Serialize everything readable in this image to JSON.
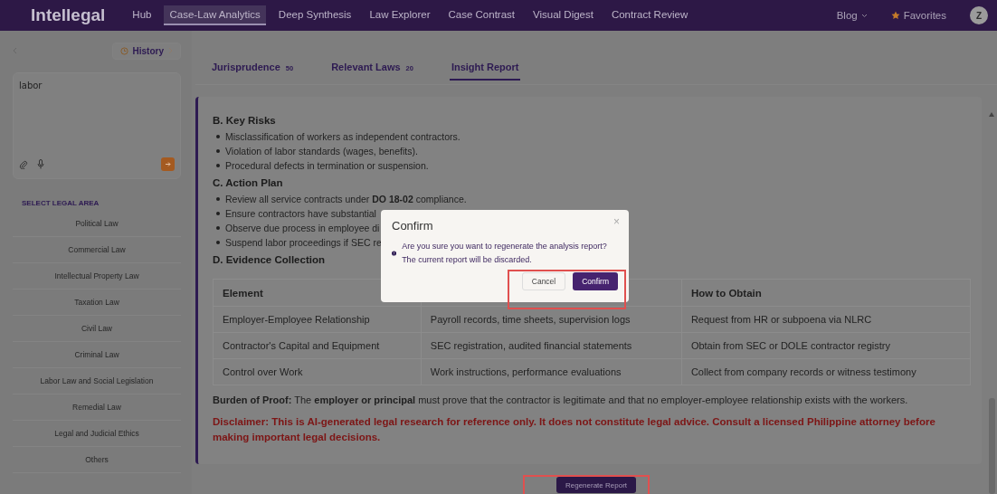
{
  "header": {
    "logo": "Intellegal",
    "nav": [
      {
        "label": "Hub",
        "selected": false
      },
      {
        "label": "Case-Law Analytics",
        "selected": true
      },
      {
        "label": "Deep Synthesis",
        "selected": false
      },
      {
        "label": "Law Explorer",
        "selected": false
      },
      {
        "label": "Case Contrast",
        "selected": false
      },
      {
        "label": "Visual Digest",
        "selected": false
      },
      {
        "label": "Contract Review",
        "selected": false
      }
    ],
    "blog": "Blog",
    "favorites": "Favorites",
    "avatar": "Z"
  },
  "sidebar": {
    "history": "History",
    "query": "labor",
    "section_title": "SELECT LEGAL AREA",
    "areas": [
      "Political Law",
      "Commercial Law",
      "Intellectual Property Law",
      "Taxation Law",
      "Civil Law",
      "Criminal Law",
      "Labor Law and Social Legislation",
      "Remedial Law",
      "Legal and Judicial Ethics",
      "Others"
    ]
  },
  "tabs": [
    {
      "label": "Jurisprudence",
      "count": "50",
      "selected": false
    },
    {
      "label": "Relevant Laws",
      "count": "20",
      "selected": false
    },
    {
      "label": "Insight Report",
      "selected": true
    }
  ],
  "report": {
    "sections": [
      {
        "kind": "heading",
        "text": "B. Key Risks"
      },
      {
        "kind": "bullets",
        "items": [
          "Misclassification of workers as independent contractors.",
          "Violation of labor standards (wages, benefits).",
          "Procedural defects in termination or suspension."
        ]
      },
      {
        "kind": "heading",
        "text": "C. Action Plan"
      },
      {
        "kind": "bullets",
        "items": [
          "Review all service contracts under **DO 18-02** compliance.",
          "Ensure contractors have substantial",
          "Observe due process in employee di",
          "Suspend labor proceedings if SEC re"
        ]
      },
      {
        "kind": "heading",
        "text": "D. Evidence Collection"
      }
    ],
    "table": {
      "columns": [
        {
          "heading": "Element"
        },
        {},
        {
          "heading": "How to Obtain"
        }
      ],
      "rows": [
        [
          "Employer-Employee Relationship",
          "Payroll records, time sheets, supervision logs",
          "Request from HR or subpoena via NLRC"
        ],
        [
          "Contractor's Capital and Equipment",
          "SEC registration, audited financial statements",
          "Obtain from SEC or DOLE contractor registry"
        ],
        [
          "Control over Work",
          "Work instructions, performance evaluations",
          "Collect from company records or witness testimony"
        ]
      ]
    },
    "burden": "**Burden of Proof:** The **employer or principal** must prove that the contractor is legitimate and that no employer-employee relationship exists with the workers.",
    "disclaimer": "Disclaimer: This is AI-generated legal research for reference only. It does not constitute legal advice. Consult a licensed Philippine attorney before making important legal decisions.",
    "regenerate": "Regenerate Report"
  },
  "dialog": {
    "title": "Confirm",
    "close": "×",
    "message": "Are you sure you want to regenerate the analysis report? The current report will be discarded.",
    "buttons": [
      {
        "label": "Cancel",
        "kind": "secondary"
      },
      {
        "label": "Confirm",
        "kind": "primary"
      }
    ]
  }
}
